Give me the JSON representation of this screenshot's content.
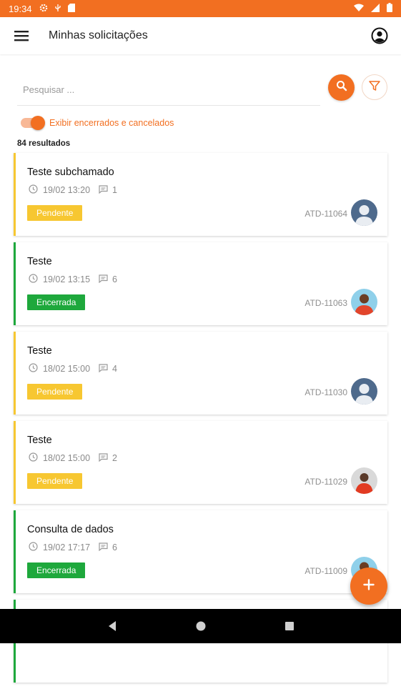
{
  "status_bar": {
    "time": "19:34"
  },
  "header": {
    "title": "Minhas solicitações"
  },
  "search": {
    "placeholder": "Pesquisar ..."
  },
  "toggle": {
    "label": "Exibir encerrados e cancelados",
    "on": true
  },
  "results": {
    "text": "84 resultados"
  },
  "colors": {
    "accent": "#f26f21",
    "pending": "#f7c731",
    "closed": "#1ea83c"
  },
  "tickets": [
    {
      "title": "Teste subchamado",
      "datetime": "19/02 13:20",
      "comments": "1",
      "status": "Pendente",
      "id": "ATD-11064",
      "avatar": "placeholder-avatar"
    },
    {
      "title": "Teste",
      "datetime": "19/02 13:15",
      "comments": "6",
      "status": "Encerrada",
      "id": "ATD-11063",
      "avatar": "person-photo-avatar"
    },
    {
      "title": "Teste",
      "datetime": "18/02 15:00",
      "comments": "4",
      "status": "Pendente",
      "id": "ATD-11030",
      "avatar": "placeholder-avatar"
    },
    {
      "title": "Teste",
      "datetime": "18/02 15:00",
      "comments": "2",
      "status": "Pendente",
      "id": "ATD-11029",
      "avatar": "person-photo-avatar"
    },
    {
      "title": "Consulta de dados",
      "datetime": "19/02 17:17",
      "comments": "6",
      "status": "Encerrada",
      "id": "ATD-11009",
      "avatar": "person-photo-avatar"
    }
  ],
  "icons": {
    "menu": "hamburger-icon",
    "account": "account-circle-icon",
    "search": "search-icon",
    "filter": "filter-icon",
    "clock": "clock-icon",
    "comment": "comment-icon",
    "fab": "plus-icon"
  }
}
